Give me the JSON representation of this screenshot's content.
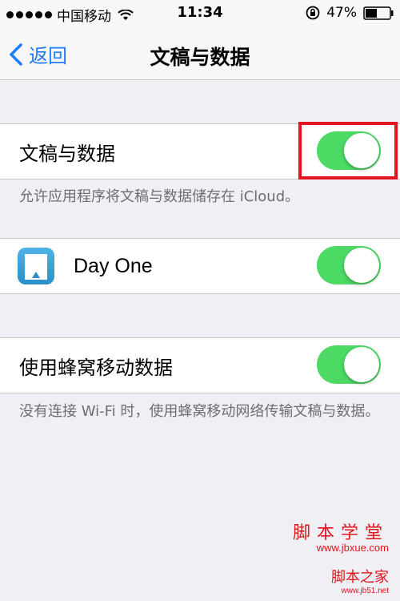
{
  "status_bar": {
    "carrier": "中国移动",
    "time": "11:34",
    "battery": "47%"
  },
  "nav": {
    "back_label": "返回",
    "title": "文稿与数据"
  },
  "section1": {
    "label": "文稿与数据",
    "toggle_on": true,
    "footer": "允许应用程序将文稿与数据储存在 iCloud。"
  },
  "section2": {
    "app_name": "Day One",
    "toggle_on": true
  },
  "section3": {
    "label": "使用蜂窝移动数据",
    "toggle_on": true,
    "footer": "没有连接 Wi-Fi 时，使用蜂窝移动网络传输文稿与数据。"
  },
  "watermark": {
    "line1": "脚本学堂",
    "line2": "www.jbxue.com",
    "line3": "脚本之家",
    "line4": "www.jb51.net"
  },
  "colors": {
    "toggle_on": "#4cd964",
    "accent": "#1e7cf6",
    "highlight": "#e0151f"
  }
}
